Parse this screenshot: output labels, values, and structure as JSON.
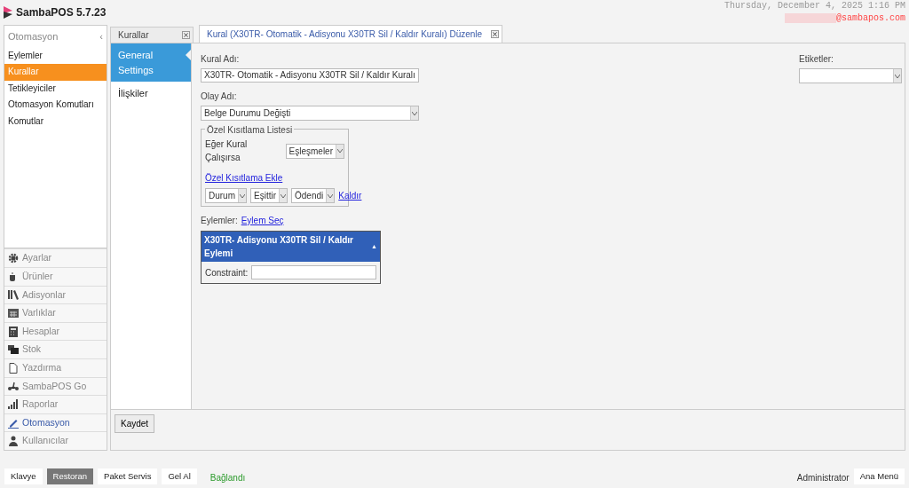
{
  "app": {
    "title": "SambaPOS 5.7.23"
  },
  "header": {
    "datetime": "Thursday, December 4, 2025 1:16 PM",
    "email": "@sambapos.com"
  },
  "sidebar": {
    "section_title": "Otomasyon",
    "collapse_glyph": "‹",
    "items": [
      {
        "label": "Eylemler",
        "selected": false
      },
      {
        "label": "Kurallar",
        "selected": true
      },
      {
        "label": "Tetikleyiciler",
        "selected": false
      },
      {
        "label": "Otomasyon Komutları",
        "selected": false
      },
      {
        "label": "Komutlar",
        "selected": false
      }
    ],
    "nav": [
      {
        "label": "Ayarlar",
        "selected": false
      },
      {
        "label": "Ürünler",
        "selected": false
      },
      {
        "label": "Adisyonlar",
        "selected": false
      },
      {
        "label": "Varlıklar",
        "selected": false
      },
      {
        "label": "Hesaplar",
        "selected": false
      },
      {
        "label": "Stok",
        "selected": false
      },
      {
        "label": "Yazdırma",
        "selected": false
      },
      {
        "label": "SambaPOS Go",
        "selected": false
      },
      {
        "label": "Raporlar",
        "selected": false
      },
      {
        "label": "Otomasyon",
        "selected": true
      },
      {
        "label": "Kullanıcılar",
        "selected": false
      }
    ]
  },
  "tabs": [
    {
      "label": "Kurallar",
      "selected": false
    },
    {
      "label": "Kural (X30TR- Otomatik - Adisyonu X30TR Sil / Kaldır Kuralı) Düzenle",
      "selected": true
    }
  ],
  "settings_tabs": [
    {
      "label": "General Settings",
      "selected": true
    },
    {
      "label": "İlişkiler",
      "selected": false
    }
  ],
  "form": {
    "rule_name_label": "Kural Adı:",
    "rule_name": "X30TR- Otomatik - Adisyonu X30TR Sil / Kaldır Kuralı",
    "event_label": "Olay Adı:",
    "event": "Belge Durumu Değişti",
    "constraints": {
      "legend": "Özel Kısıtlama Listesi",
      "run_if_label": "Eğer Kural Çalışırsa",
      "run_if": "Eşleşmeler",
      "add_link": "Özel Kısıtlama Ekle",
      "rows": [
        {
          "field": "Durum",
          "operator": "Eşittir",
          "value": "Ödendi",
          "remove_link": "Kaldır"
        }
      ]
    },
    "actions_label": "Eylemler:",
    "select_action_link": "Eylem Seç",
    "actions": [
      {
        "title": "X30TR- Adisyonu X30TR Sil / Kaldır Eylemi",
        "collapse_glyph": "▲",
        "constraint_label": "Constraint:"
      }
    ],
    "tags_label": "Etiketler:"
  },
  "save_button": "Kaydet",
  "footer": {
    "modes": [
      {
        "label": "Klavye",
        "selected": false
      },
      {
        "label": "Restoran",
        "selected": true
      },
      {
        "label": "Paket Servis",
        "selected": false
      },
      {
        "label": "Gel Al",
        "selected": false
      }
    ],
    "status": "Bağlandı",
    "user": "Administrator",
    "main_menu": "Ana Menü"
  }
}
